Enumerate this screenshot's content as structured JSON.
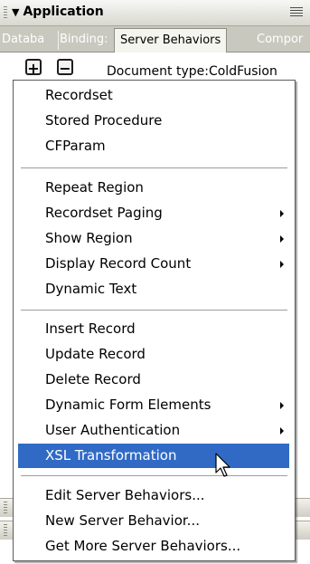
{
  "panel": {
    "title": "Application",
    "tabs": [
      {
        "label": "Databa"
      },
      {
        "label": "Binding:"
      },
      {
        "label": "Server Behaviors",
        "active": true
      },
      {
        "label": "Compor"
      }
    ]
  },
  "toolbar": {
    "add_label": "+",
    "remove_label": "−",
    "document_type": "Document type:ColdFusion"
  },
  "menu": {
    "group1": [
      "Recordset",
      "Stored Procedure",
      "CFParam"
    ],
    "group2": [
      {
        "label": "Repeat Region",
        "submenu": false
      },
      {
        "label": "Recordset Paging",
        "submenu": true
      },
      {
        "label": "Show Region",
        "submenu": true
      },
      {
        "label": "Display Record Count",
        "submenu": true
      },
      {
        "label": "Dynamic Text",
        "submenu": false
      }
    ],
    "group3": [
      {
        "label": "Insert Record",
        "submenu": false
      },
      {
        "label": "Update Record",
        "submenu": false
      },
      {
        "label": "Delete Record",
        "submenu": false
      },
      {
        "label": "Dynamic Form Elements",
        "submenu": true
      },
      {
        "label": "User Authentication",
        "submenu": true
      },
      {
        "label": "XSL Transformation",
        "submenu": false,
        "highlighted": true
      }
    ],
    "group4": [
      "Edit Server Behaviors...",
      "New Server Behavior...",
      "Get More Server Behaviors..."
    ]
  },
  "colors": {
    "highlight": "#316ac5",
    "tab_bar": "#c9c8be"
  }
}
